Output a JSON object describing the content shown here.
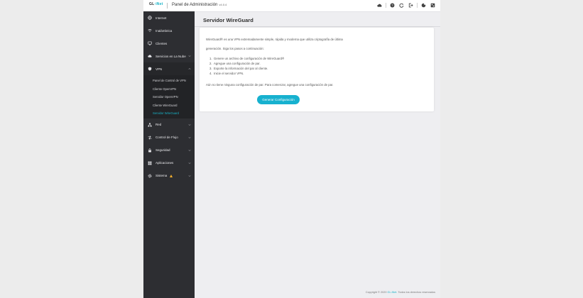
{
  "header": {
    "logo_main": "GL",
    "logo_accent": "·iNet",
    "title": "Panel de Administración",
    "version": "v4.0.4",
    "icons": [
      "cloud-icon",
      "help-icon",
      "reboot-icon",
      "logout-icon",
      "theme-icon",
      "language-icon"
    ]
  },
  "sidebar": {
    "items": [
      {
        "label": "Internet",
        "icon": "globe-icon"
      },
      {
        "label": "Inalámbrica",
        "icon": "wifi-icon"
      },
      {
        "label": "Clientes",
        "icon": "monitor-icon"
      },
      {
        "label": "Servicios en La Nube",
        "icon": "cloud-icon"
      },
      {
        "label": "VPN",
        "icon": "shield-icon"
      },
      {
        "label": "Red",
        "icon": "network-icon"
      },
      {
        "label": "Control de Flujo",
        "icon": "flow-icon"
      },
      {
        "label": "Seguridad",
        "icon": "lock-icon"
      },
      {
        "label": "Aplicaciones",
        "icon": "apps-icon"
      },
      {
        "label": "Sistema",
        "icon": "gear-icon"
      }
    ],
    "vpn_sub": [
      {
        "label": "Panel de Control de VPN"
      },
      {
        "label": "Cliente OpenVPN"
      },
      {
        "label": "Servidor OpenVPN"
      },
      {
        "label": "Cliente WireGuard"
      },
      {
        "label": "Servidor WireGuard"
      }
    ],
    "active_sub": "Servidor WireGuard"
  },
  "main": {
    "title": "Servidor WireGuard",
    "intro_line1": "WireGuard® es una VPN extremadamente simple, rápida y moderna que utiliza criptografía de última",
    "intro_line2": "generación. Siga los pasos a continuación:",
    "steps": [
      {
        "num": "1.",
        "text": "Genere un archivo de configuración de WireGuard®"
      },
      {
        "num": "2.",
        "text": "Agregue una configuración de par."
      },
      {
        "num": "3.",
        "text": "Exporte la información del par al cliente."
      },
      {
        "num": "4.",
        "text": "Inicie el servidor VPN."
      }
    ],
    "note": "Aún no tiene ninguna configuración de par. Para comenzar, agregue una configuración de par.",
    "button_label": "Generar Configuración"
  },
  "footer": {
    "prefix": "Copyright © 2020",
    "link": "GL.iNet.",
    "suffix": "Todos los derechos reservados"
  },
  "colors": {
    "accent": "#19b3c7",
    "button": "#17b1cf",
    "sidebar_bg": "#2d2e32",
    "warning": "#f0ad2e"
  }
}
